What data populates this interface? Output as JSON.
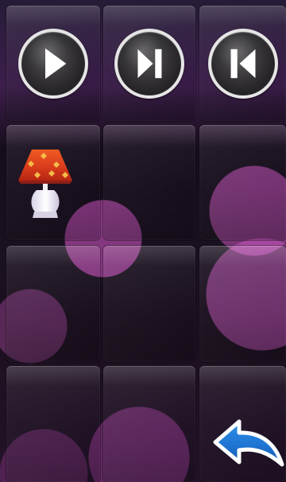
{
  "screen": {
    "background_accent": "#d25bcb",
    "tile_base": "#211b25"
  },
  "controls": {
    "play": {
      "icon": "play-icon",
      "color": "#ffffff"
    },
    "next": {
      "icon": "next-track-icon",
      "color": "#ffffff"
    },
    "previous": {
      "icon": "previous-track-icon",
      "color": "#ffffff"
    }
  },
  "tiles": {
    "lamp": {
      "icon": "lamp-icon",
      "shade_color": "#e94b22",
      "base_color": "#e8e4f3"
    },
    "back": {
      "icon": "back-arrow-icon",
      "fill_color": "#1d78d8",
      "outline_color": "#ffffff"
    }
  }
}
